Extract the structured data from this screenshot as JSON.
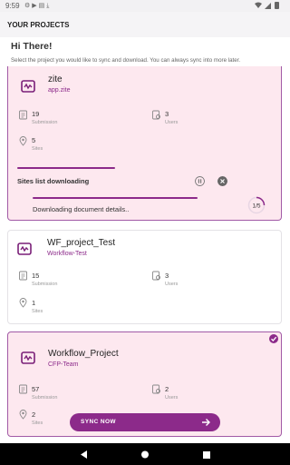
{
  "status_bar": {
    "time": "9:59",
    "left_icons": [
      "settings-icon",
      "play-icon",
      "file-icon",
      "download-icon"
    ],
    "right_icons": [
      "wifi-icon",
      "signal-icon",
      "battery-icon"
    ]
  },
  "app_bar": {
    "title": "YOUR PROJECTS"
  },
  "greeting": "Hi There!",
  "subtitle": "Select the project you would like to sync and download. You can always sync into more later.",
  "colors": {
    "accent": "#8c2a8a",
    "selected_card_bg": "#fde8ef",
    "selected_card_border": "#a15aa6"
  },
  "projects": [
    {
      "name": "zite",
      "code": "app.zite",
      "submissions": "19",
      "submissions_label": "Submission",
      "users": "3",
      "users_label": "Users",
      "sites": "5",
      "sites_label": "Sites",
      "selected": true,
      "download": {
        "sites_label": "Sites list downloading",
        "document_label": "Downloading document details..",
        "step": "1/5"
      }
    },
    {
      "name": "WF_project_Test",
      "code": "Workflow-Test",
      "submissions": "15",
      "submissions_label": "Submission",
      "users": "3",
      "users_label": "Users",
      "sites": "1",
      "sites_label": "Sites",
      "selected": false
    },
    {
      "name": "Workflow_Project",
      "code": "CFP-Team",
      "submissions": "57",
      "submissions_label": "Submission",
      "users": "2",
      "users_label": "Users",
      "sites": "2",
      "sites_label": "Sites",
      "selected": true
    }
  ],
  "sync_button": {
    "label": "SYNC NOW"
  }
}
